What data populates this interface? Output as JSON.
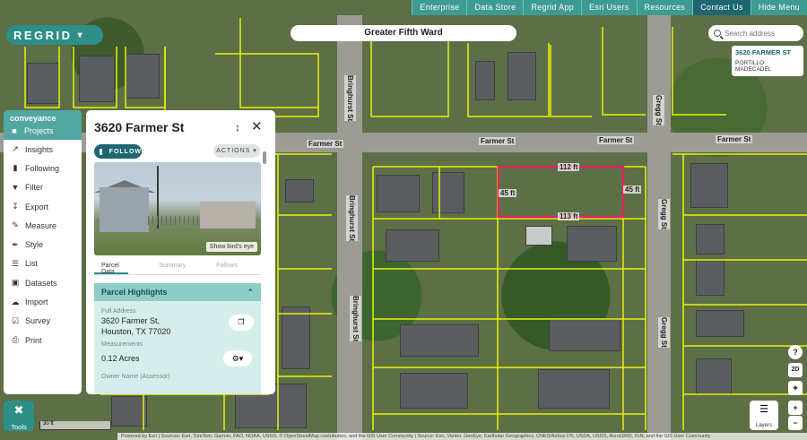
{
  "topnav": {
    "items": [
      "Enterprise",
      "Data Store",
      "Regrid App",
      "Esri Users",
      "Resources",
      "Contact Us",
      "Hide Menu"
    ],
    "active_index": 5
  },
  "logo": {
    "text": "REGRID"
  },
  "area_title": "Greater Fifth Ward",
  "search": {
    "placeholder": "Search address"
  },
  "address_tag": {
    "line1": "3620 FARMER ST",
    "line2": "PORTILLO MADECADEL"
  },
  "sidebar": {
    "org": "conveyance",
    "header_item": "Projects",
    "items": [
      "Insights",
      "Following",
      "Filter",
      "Export",
      "Measure",
      "Style",
      "List",
      "Datasets",
      "Import",
      "Survey",
      "Print"
    ]
  },
  "tools": {
    "label": "Tools"
  },
  "scale": {
    "label": "30 ft"
  },
  "panel": {
    "title": "3620 Farmer St",
    "follow_label": "FOLLOW",
    "actions_label": "ACTIONS ▾",
    "photo_link": "Show bird's eye",
    "tabs": [
      "Parcel Data",
      "Summary",
      "Follows"
    ],
    "highlights": {
      "heading": "Parcel Highlights",
      "full_address_label": "Full Address",
      "address_line1": "3620 Farmer St,",
      "address_line2": "Houston, TX 77020",
      "measurements_label": "Measurements",
      "measurements_value": "0.12 Acres",
      "owner_label": "Owner Name (Assessor)"
    }
  },
  "map": {
    "street_labels": [
      "Farmer St",
      "Farmer St",
      "Farmer St",
      "Farmer St",
      "Bringhurst St",
      "Bringhurst St",
      "Bringhurst St",
      "Gregg St",
      "Gregg St",
      "Gregg St"
    ],
    "parcel_dimensions": [
      "112 ft",
      "45 ft",
      "45 ft",
      "113 ft"
    ],
    "parcel_color": "#e0245e",
    "parcel_line_color": "#e5f20a"
  },
  "controls": {
    "help": "?",
    "mode": "2D",
    "plus": "+",
    "minus": "−",
    "layers_label": "Layers"
  },
  "attribution": "Powered by Esri | Sources: Esri, TomTom, Garmin, FAO, NOAA, USGS, © OpenStreetMap contributors, and the GIS User Community | Source: Esri, Vantor, GeoEye, Earthstar Geographics, CNES/Airbus DS, USDA, USGS, AeroGRID, IGN, and the GIS User Community"
}
